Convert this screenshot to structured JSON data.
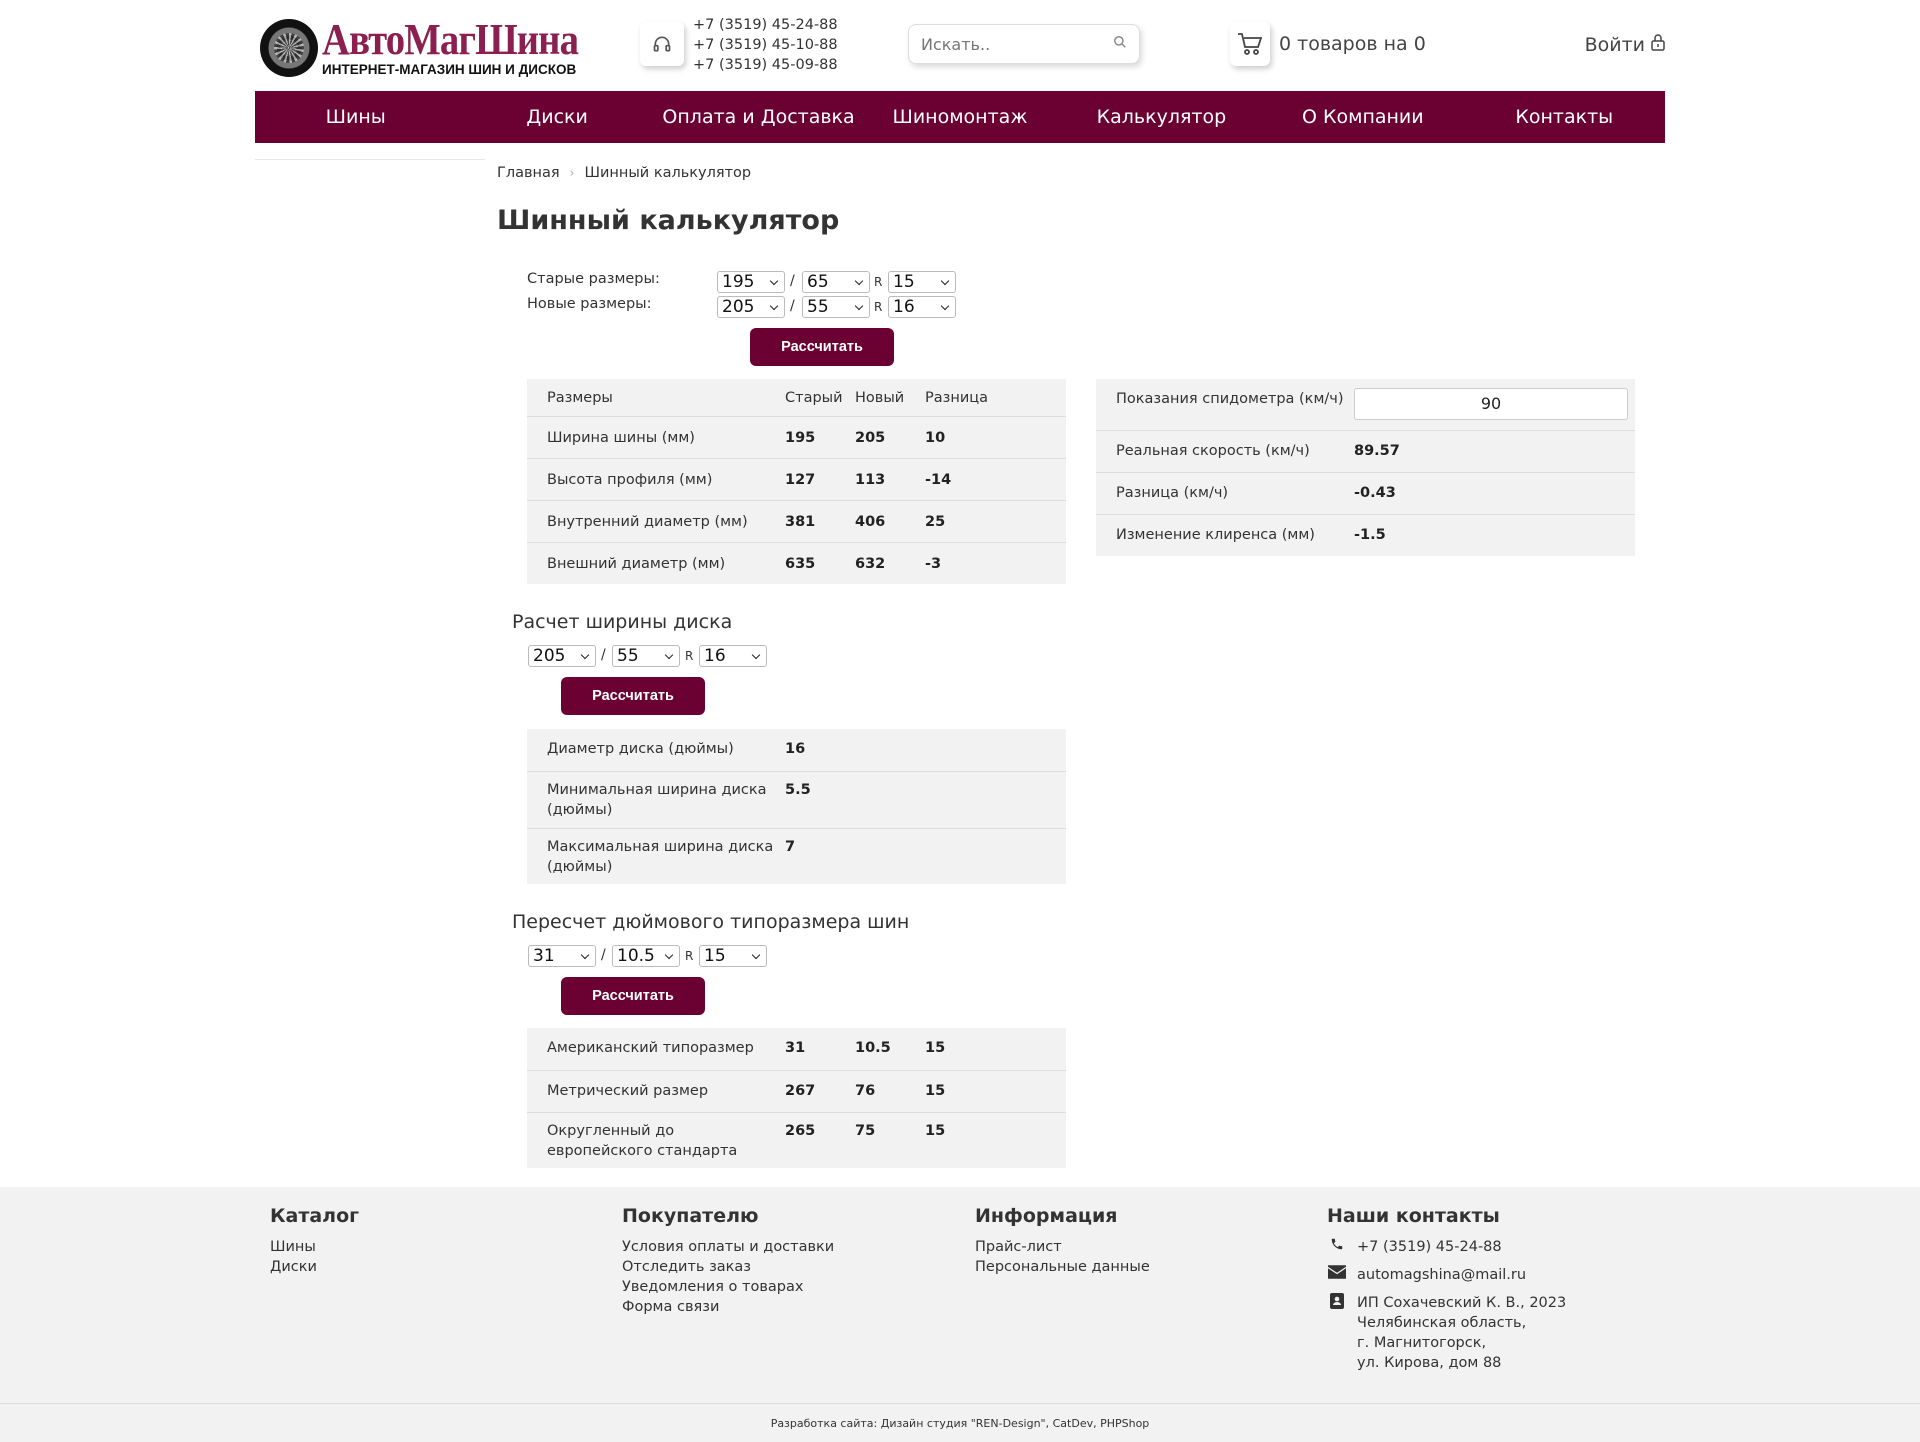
{
  "header": {
    "logo_title": "АвтоМагШина",
    "logo_subtitle": "ИНТЕРНЕТ-МАГАЗИН ШИН И ДИСКОВ",
    "phones": [
      "+7 (3519) 45-24-88",
      "+7 (3519) 45-10-88",
      "+7 (3519) 45-09-88"
    ],
    "search_placeholder": "Искать..",
    "cart_text": "0 товаров на 0",
    "login": "Войти"
  },
  "nav": [
    "Шины",
    "Диски",
    "Оплата и Доставка",
    "Шиномонтаж",
    "Калькулятор",
    "О Компании",
    "Контакты"
  ],
  "breadcrumb": [
    "Главная",
    "Шинный калькулятор"
  ],
  "page_title": "Шинный калькулятор",
  "calc1": {
    "old_label": "Старые размеры:",
    "new_label": "Новые размеры:",
    "old": {
      "width": "195",
      "profile": "65",
      "radius": "15"
    },
    "new": {
      "width": "205",
      "profile": "55",
      "radius": "16"
    },
    "slash": "/",
    "r": "R",
    "button": "Рассчитать",
    "table_header": [
      "Размеры",
      "Старый",
      "Новый",
      "Разница"
    ],
    "rows": [
      [
        "Ширина шины (мм)",
        "195",
        "205",
        "10"
      ],
      [
        "Высота профиля (мм)",
        "127",
        "113",
        "-14"
      ],
      [
        "Внутренний диаметр (мм)",
        "381",
        "406",
        "25"
      ],
      [
        "Внешний диаметр (мм)",
        "635",
        "632",
        "-3"
      ]
    ]
  },
  "speed": {
    "rows": [
      [
        "Показания спидометра (км/ч)",
        "90"
      ],
      [
        "Реальная скорость (км/ч)",
        "89.57"
      ],
      [
        "Разница (км/ч)",
        "-0.43"
      ],
      [
        "Изменение клиренса (мм)",
        "-1.5"
      ]
    ]
  },
  "calc2": {
    "title": "Расчет ширины диска",
    "sel": {
      "width": "205",
      "profile": "55",
      "radius": "16"
    },
    "button": "Рассчитать",
    "rows": [
      [
        "Диаметр диска (дюймы)",
        "16"
      ],
      [
        "Минимальная ширина диска (дюймы)",
        "5.5"
      ],
      [
        "Максимальная ширина диска (дюймы)",
        "7"
      ]
    ]
  },
  "calc3": {
    "title": "Пересчет дюймового типоразмера шин",
    "sel": {
      "width": "31",
      "profile": "10.5",
      "radius": "15"
    },
    "button": "Рассчитать",
    "rows": [
      [
        "Американский типоразмер",
        "31",
        "10.5",
        "15"
      ],
      [
        "Метрический размер",
        "267",
        "76",
        "15"
      ],
      [
        "Округленный до европейского стандарта",
        "265",
        "75",
        "15"
      ]
    ]
  },
  "footer": {
    "catalog": {
      "title": "Каталог",
      "items": [
        "Шины",
        "Диски"
      ]
    },
    "buyer": {
      "title": "Покупателю",
      "items": [
        "Условия оплаты и доставки",
        "Отследить заказ",
        "Уведомления о товарах",
        "Форма связи"
      ]
    },
    "info": {
      "title": "Информация",
      "items": [
        "Прайс-лист",
        "Персональные данные"
      ]
    },
    "contacts": {
      "title": "Наши контакты",
      "phone": "+7 (3519) 45-24-88",
      "email": "automagshina@mail.ru",
      "address": [
        "ИП Сохачевский К. В., 2023",
        "Челябинская область,",
        "г. Магнитогорск,",
        "ул. Кирова, дом 88"
      ]
    },
    "credits": "Разработка сайта: Дизайн студия \"REN-Design\", CatDev, PHPShop"
  },
  "colors": {
    "brand": "#6b0032",
    "logo": "#8b1f4f",
    "table_bg": "#f2f2f2",
    "footer_bg": "#f1f2f1"
  }
}
